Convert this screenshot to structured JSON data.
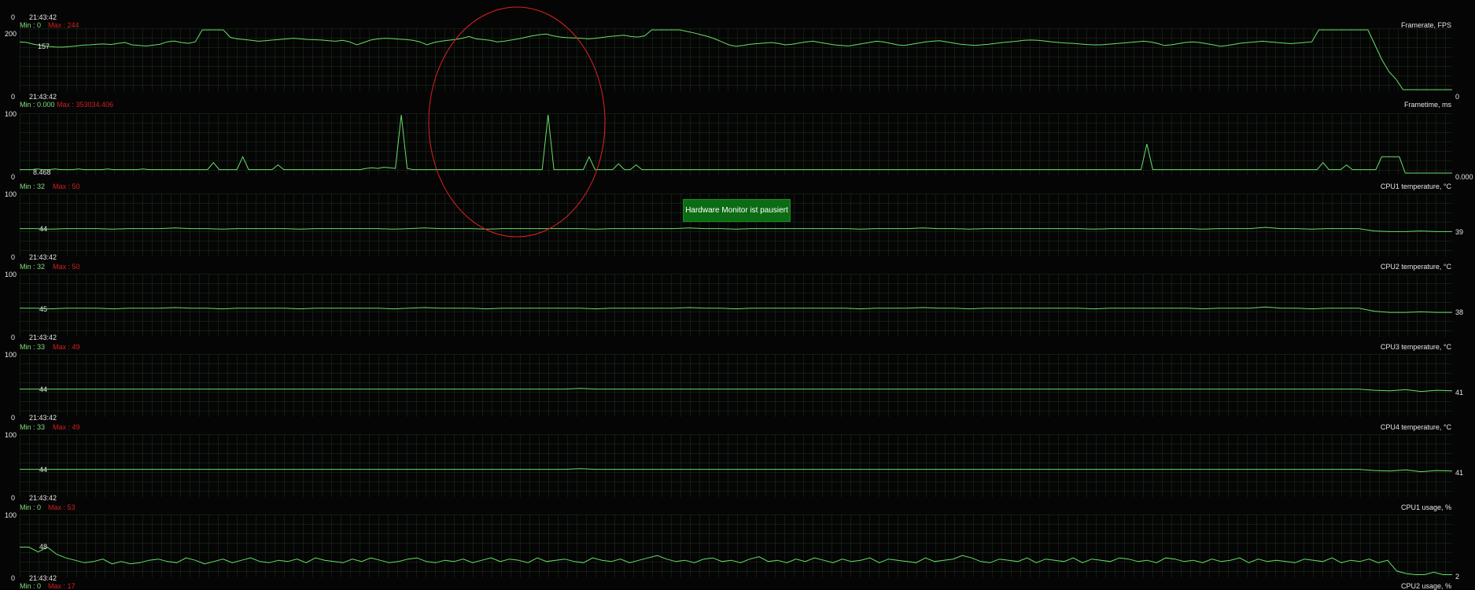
{
  "badge": {
    "label": "Hardware Monitor ist pausiert"
  },
  "accent": {
    "trace": "#66e066",
    "grid": "#1e3a1e",
    "max": "#d02020",
    "badge": "#0c6c13",
    "annotation": "#e02020"
  },
  "panels": [
    {
      "title": "Framerate, FPS",
      "time": "21:43:42",
      "min_label": "Min : 0",
      "max_label": "Max : 244",
      "y_top": "200",
      "y_bottom": "0",
      "start_value": "157",
      "end_value": "0",
      "series": [
        160,
        158,
        152,
        148,
        145,
        143,
        142,
        144,
        146,
        149,
        150,
        152,
        153,
        151,
        155,
        158,
        150,
        148,
        146,
        149,
        152,
        160,
        163,
        158,
        155,
        160,
        200,
        200,
        200,
        200,
        175,
        170,
        168,
        165,
        162,
        164,
        166,
        168,
        170,
        172,
        170,
        168,
        167,
        166,
        164,
        162,
        165,
        160,
        150,
        158,
        166,
        170,
        172,
        171,
        169,
        168,
        165,
        160,
        150,
        158,
        162,
        165,
        168,
        172,
        178,
        170,
        168,
        165,
        160,
        162,
        166,
        170,
        175,
        180,
        184,
        186,
        180,
        176,
        174,
        173,
        172,
        170,
        172,
        175,
        178,
        180,
        182,
        178,
        176,
        180,
        200,
        200,
        200,
        200,
        200,
        195,
        190,
        184,
        178,
        170,
        160,
        150,
        145,
        148,
        152,
        154,
        156,
        158,
        155,
        150,
        152,
        156,
        160,
        162,
        158,
        154,
        150,
        148,
        146,
        150,
        154,
        158,
        162,
        160,
        155,
        150,
        148,
        152,
        156,
        160,
        162,
        164,
        160,
        156,
        152,
        150,
        148,
        150,
        152,
        155,
        158,
        160,
        162,
        165,
        166,
        165,
        163,
        160,
        158,
        156,
        155,
        153,
        151,
        150,
        150,
        152,
        154,
        156,
        158,
        160,
        162,
        160,
        155,
        148,
        150,
        154,
        158,
        160,
        158,
        154,
        150,
        145,
        148,
        152,
        156,
        158,
        160,
        162,
        160,
        158,
        156,
        154,
        156,
        158,
        160,
        200,
        200,
        200,
        200,
        200,
        200,
        200,
        200,
        150,
        100,
        60,
        35,
        0,
        0,
        0,
        0,
        0,
        0,
        0,
        0
      ]
    },
    {
      "title": "Frametime, ms",
      "time": "21:43:42",
      "min_label": "Min : 0.000",
      "max_label": "Max : 353034.406",
      "y_top": "100",
      "y_bottom": "0",
      "start_value": "8.468",
      "end_value": "0.000",
      "series": [
        6,
        6,
        6,
        7,
        6,
        6,
        7,
        6,
        6,
        6,
        7,
        6,
        6,
        6,
        6,
        7,
        6,
        6,
        6,
        6,
        6,
        7,
        6,
        6,
        6,
        6,
        6,
        6,
        6,
        6,
        6,
        6,
        6,
        18,
        6,
        6,
        6,
        6,
        28,
        6,
        6,
        6,
        6,
        6,
        14,
        6,
        6,
        6,
        6,
        6,
        6,
        6,
        6,
        6,
        6,
        6,
        6,
        6,
        6,
        8,
        9,
        8,
        10,
        9,
        8,
        100,
        8,
        6,
        6,
        6,
        6,
        6,
        6,
        6,
        6,
        6,
        6,
        6,
        6,
        6,
        6,
        6,
        6,
        6,
        6,
        6,
        6,
        6,
        6,
        6,
        100,
        6,
        6,
        6,
        6,
        6,
        6,
        28,
        6,
        6,
        6,
        6,
        16,
        6,
        6,
        14,
        6,
        6,
        6,
        6,
        6,
        6,
        6,
        6,
        6,
        6,
        6,
        6,
        6,
        6,
        6,
        6,
        6,
        6,
        6,
        6,
        6,
        6,
        6,
        6,
        6,
        6,
        6,
        6,
        6,
        6,
        6,
        6,
        6,
        6,
        6,
        6,
        6,
        6,
        6,
        6,
        6,
        6,
        6,
        6,
        6,
        6,
        6,
        6,
        6,
        6,
        6,
        6,
        6,
        6,
        6,
        6,
        6,
        6,
        6,
        6,
        6,
        6,
        6,
        6,
        6,
        6,
        6,
        6,
        6,
        6,
        6,
        6,
        6,
        6,
        6,
        6,
        6,
        6,
        6,
        6,
        6,
        6,
        6,
        6,
        6,
        6,
        50,
        6,
        6,
        6,
        6,
        6,
        6,
        6,
        6,
        6,
        6,
        6,
        6,
        6,
        6,
        6,
        6,
        6,
        6,
        6,
        6,
        6,
        6,
        6,
        6,
        6,
        6,
        6,
        6,
        6,
        18,
        6,
        6,
        6,
        14,
        6,
        6,
        6,
        6,
        6,
        28,
        28,
        28,
        28,
        0,
        0,
        0,
        0,
        0,
        0,
        0,
        0,
        0
      ]
    },
    {
      "title": "CPU1 temperature, °C",
      "time": "21:43:42",
      "min_label": "Min : 32",
      "max_label": "Max : 50",
      "y_top": "100",
      "y_bottom": "0",
      "start_value": "44",
      "end_value": "39",
      "series": [
        44,
        44,
        43,
        44,
        44,
        44,
        43,
        44,
        44,
        44,
        45,
        44,
        44,
        43,
        44,
        44,
        44,
        44,
        43,
        44,
        44,
        44,
        44,
        44,
        43,
        44,
        45,
        44,
        44,
        44,
        43,
        44,
        44,
        44,
        44,
        44,
        44,
        43,
        44,
        44,
        44,
        44,
        44,
        45,
        44,
        44,
        43,
        44,
        44,
        44,
        44,
        44,
        44,
        44,
        43,
        44,
        44,
        44,
        45,
        44,
        44,
        43,
        44,
        44,
        44,
        44,
        44,
        44,
        44,
        43,
        44,
        44,
        44,
        44,
        44,
        44,
        43,
        44,
        44,
        44,
        46,
        44,
        44,
        43,
        44,
        44,
        44,
        40,
        39,
        39,
        40,
        39,
        39
      ]
    },
    {
      "title": "CPU2 temperature, °C",
      "time": "21:43:42",
      "min_label": "Min : 32",
      "max_label": "Max : 50",
      "y_top": "100",
      "y_bottom": "0",
      "start_value": "45",
      "end_value": "38",
      "series": [
        45,
        45,
        44,
        45,
        45,
        45,
        44,
        45,
        45,
        45,
        46,
        45,
        45,
        44,
        45,
        45,
        45,
        45,
        44,
        45,
        45,
        45,
        45,
        45,
        44,
        45,
        46,
        45,
        45,
        45,
        44,
        45,
        45,
        45,
        45,
        45,
        45,
        44,
        45,
        45,
        45,
        45,
        45,
        46,
        45,
        45,
        44,
        45,
        45,
        45,
        45,
        45,
        45,
        45,
        44,
        45,
        45,
        45,
        46,
        45,
        45,
        44,
        45,
        45,
        45,
        45,
        45,
        45,
        45,
        44,
        45,
        45,
        45,
        45,
        45,
        45,
        44,
        45,
        45,
        45,
        47,
        45,
        45,
        44,
        45,
        45,
        45,
        40,
        38,
        38,
        39,
        38,
        38
      ]
    },
    {
      "title": "CPU3 temperature, °C",
      "time": "21:43:42",
      "min_label": "Min : 33",
      "max_label": "Max : 49",
      "y_top": "100",
      "y_bottom": "0",
      "start_value": "44",
      "end_value": "41",
      "series": [
        44,
        44,
        44,
        44,
        44,
        44,
        44,
        44,
        44,
        44,
        44,
        44,
        44,
        44,
        44,
        44,
        44,
        44,
        44,
        44,
        44,
        44,
        44,
        44,
        44,
        44,
        44,
        44,
        44,
        44,
        44,
        44,
        44,
        44,
        44,
        44,
        45,
        44,
        44,
        44,
        44,
        44,
        44,
        44,
        44,
        44,
        44,
        44,
        44,
        44,
        44,
        44,
        44,
        44,
        44,
        44,
        44,
        44,
        44,
        44,
        44,
        44,
        44,
        44,
        44,
        44,
        44,
        44,
        44,
        44,
        44,
        44,
        44,
        44,
        44,
        44,
        44,
        44,
        44,
        44,
        44,
        44,
        44,
        44,
        44,
        44,
        44,
        42,
        41,
        43,
        40,
        42,
        41
      ]
    },
    {
      "title": "CPU4 temperature, °C",
      "time": "21:43:42",
      "min_label": "Min : 33",
      "max_label": "Max : 49",
      "y_top": "100",
      "y_bottom": "0",
      "start_value": "44",
      "end_value": "41",
      "series": [
        44,
        44,
        44,
        44,
        44,
        44,
        44,
        44,
        44,
        44,
        44,
        44,
        44,
        44,
        44,
        44,
        44,
        44,
        44,
        44,
        44,
        44,
        44,
        44,
        44,
        44,
        44,
        44,
        44,
        44,
        44,
        44,
        44,
        44,
        44,
        44,
        45,
        44,
        44,
        44,
        44,
        44,
        44,
        44,
        44,
        44,
        44,
        44,
        44,
        44,
        44,
        44,
        44,
        44,
        44,
        44,
        44,
        44,
        44,
        44,
        44,
        44,
        44,
        44,
        44,
        44,
        44,
        44,
        44,
        44,
        44,
        44,
        44,
        44,
        44,
        44,
        44,
        44,
        44,
        44,
        44,
        44,
        44,
        44,
        44,
        44,
        44,
        42,
        41,
        43,
        40,
        42,
        41
      ]
    },
    {
      "title": "CPU1 usage, %",
      "time": "21:43:42",
      "min_label": "Min : 0",
      "max_label": "Max : 53",
      "y_top": "100",
      "y_bottom": "0",
      "start_value": "48",
      "end_value": "2",
      "series": [
        48,
        48,
        40,
        48,
        36,
        30,
        26,
        22,
        24,
        28,
        20,
        24,
        20,
        22,
        26,
        28,
        24,
        22,
        30,
        26,
        20,
        24,
        28,
        22,
        26,
        30,
        24,
        22,
        26,
        24,
        28,
        22,
        30,
        26,
        24,
        22,
        28,
        24,
        30,
        26,
        22,
        24,
        28,
        30,
        24,
        22,
        26,
        24,
        28,
        22,
        26,
        30,
        24,
        28,
        26,
        22,
        30,
        24,
        26,
        28,
        24,
        22,
        30,
        26,
        24,
        28,
        22,
        26,
        30,
        34,
        28,
        24,
        26,
        22,
        28,
        30,
        24,
        26,
        22,
        28,
        32,
        24,
        26,
        22,
        28,
        24,
        30,
        26,
        22,
        28,
        24,
        26,
        30,
        22,
        28,
        26,
        24,
        22,
        30,
        24,
        26,
        28,
        34,
        30,
        24,
        22,
        28,
        26,
        24,
        30,
        22,
        28,
        26,
        24,
        30,
        22,
        28,
        26,
        24,
        30,
        28,
        24,
        26,
        22,
        30,
        28,
        24,
        26,
        22,
        28,
        24,
        26,
        30,
        22,
        28,
        24,
        26,
        24,
        22,
        28,
        26,
        24,
        30,
        22,
        26,
        24,
        28,
        22,
        26,
        8,
        4,
        2,
        2,
        6,
        2,
        2
      ]
    }
  ],
  "cpu2_panel": {
    "title": "CPU2 usage, %",
    "time": "21:43:42",
    "min_label": "Min : 0",
    "max_label": "Max : 17",
    "y_bottom": "0"
  }
}
